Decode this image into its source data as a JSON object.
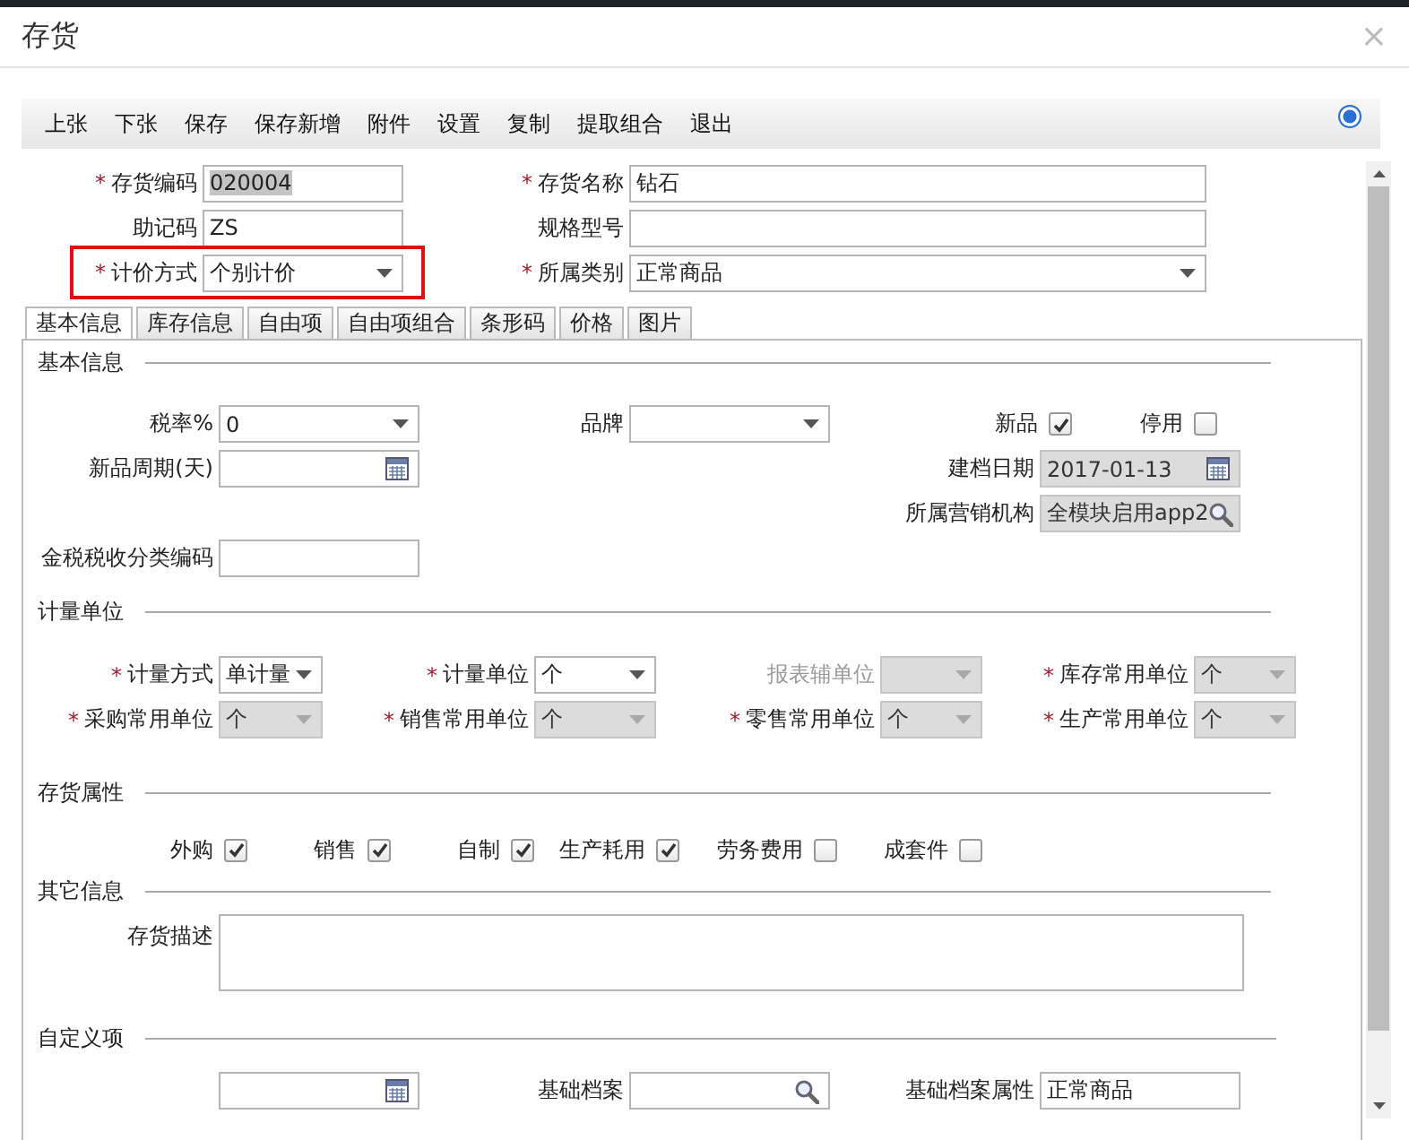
{
  "window": {
    "title": "存货",
    "close": "×"
  },
  "toolbar": {
    "buttons": [
      "上张",
      "下张",
      "保存",
      "保存新增",
      "附件",
      "设置",
      "复制",
      "提取组合",
      "退出"
    ]
  },
  "header": {
    "fields": [
      {
        "mark": "*",
        "label": "存货编码",
        "kind": "text",
        "value": "020004",
        "text_selected": true,
        "highlighted": false
      },
      {
        "mark": "*",
        "label": "存货名称",
        "kind": "text",
        "value": "钻石",
        "highlighted": false
      },
      {
        "label": "助记码",
        "kind": "text",
        "value": "ZS",
        "highlighted": false
      },
      {
        "label": "规格型号",
        "kind": "text",
        "highlighted": false
      },
      {
        "mark": "*",
        "label": "计价方式",
        "kind": "select",
        "value": "个别计价",
        "highlighted": true
      },
      {
        "mark": "*",
        "label": "所属类别",
        "kind": "select",
        "value": "正常商品",
        "highlighted": false
      }
    ]
  },
  "tabs": [
    {
      "label": "基本信息",
      "selected": true
    },
    {
      "label": "库存信息",
      "selected": false
    },
    {
      "label": "自由项",
      "selected": false
    },
    {
      "label": "自由项组合",
      "selected": false
    },
    {
      "label": "条形码",
      "selected": false
    },
    {
      "label": "价格",
      "selected": false
    },
    {
      "label": "图片",
      "selected": false
    }
  ],
  "sections": [
    {
      "kind": "basic",
      "title": "基本信息",
      "fields": [
        {
          "label": "税率%",
          "kind": "select",
          "value": "0",
          "disabled": false
        },
        {
          "label": "品牌",
          "kind": "select",
          "disabled": false
        },
        {
          "kind": "checks",
          "items": [
            {
              "label": "新品",
              "checked": true
            },
            {
              "label": "停用",
              "checked": false
            }
          ]
        },
        {
          "label": "新品周期(天)",
          "kind": "date",
          "disabled": false
        },
        {
          "label": "建档日期",
          "kind": "date",
          "value": "2017-01-13",
          "disabled": true
        },
        {
          "label": "所属营销机构",
          "kind": "lookup",
          "value": "全模块启用app2",
          "disabled": true
        },
        {
          "label": "金税税收分类编码",
          "kind": "text",
          "disabled": false
        }
      ]
    },
    {
      "kind": "units",
      "title": "计量单位",
      "fields": [
        {
          "mark": "*",
          "label": "计量方式",
          "kind": "select",
          "value": "单计量",
          "disabled": false,
          "label_greyed": false
        },
        {
          "mark": "*",
          "label": "计量单位",
          "kind": "select",
          "value": "个",
          "disabled": false,
          "label_greyed": false
        },
        {
          "label": "报表辅单位",
          "kind": "select",
          "disabled": true,
          "label_greyed": true
        },
        {
          "mark": "*",
          "label": "库存常用单位",
          "kind": "select",
          "value": "个",
          "disabled": true,
          "label_greyed": false
        },
        {
          "mark": "*",
          "label": "采购常用单位",
          "kind": "select",
          "value": "个",
          "disabled": true,
          "label_greyed": false
        },
        {
          "mark": "*",
          "label": "销售常用单位",
          "kind": "select",
          "value": "个",
          "disabled": true,
          "label_greyed": false
        },
        {
          "mark": "*",
          "label": "零售常用单位",
          "kind": "select",
          "value": "个",
          "disabled": true,
          "label_greyed": false
        },
        {
          "mark": "*",
          "label": "生产常用单位",
          "kind": "select",
          "value": "个",
          "disabled": true,
          "label_greyed": false
        }
      ]
    },
    {
      "kind": "attributes",
      "title": "存货属性",
      "items": [
        {
          "label": "外购",
          "checked": true
        },
        {
          "label": "销售",
          "checked": true
        },
        {
          "label": "自制",
          "checked": true
        },
        {
          "label": "生产耗用",
          "checked": true
        },
        {
          "label": "劳务费用",
          "checked": false
        },
        {
          "label": "成套件",
          "checked": false
        }
      ]
    },
    {
      "kind": "memo",
      "title": "其它信息",
      "fields": [
        {
          "label": "存货描述",
          "kind": "area",
          "disabled": false
        }
      ]
    },
    {
      "kind": "custom",
      "title": "自定义项",
      "fields": [
        {
          "kind": "date",
          "disabled": false
        },
        {
          "label": "基础档案",
          "kind": "lookup",
          "disabled": false
        },
        {
          "label": "基础档案属性",
          "kind": "text",
          "value": "正常商品",
          "disabled": false
        }
      ]
    }
  ]
}
